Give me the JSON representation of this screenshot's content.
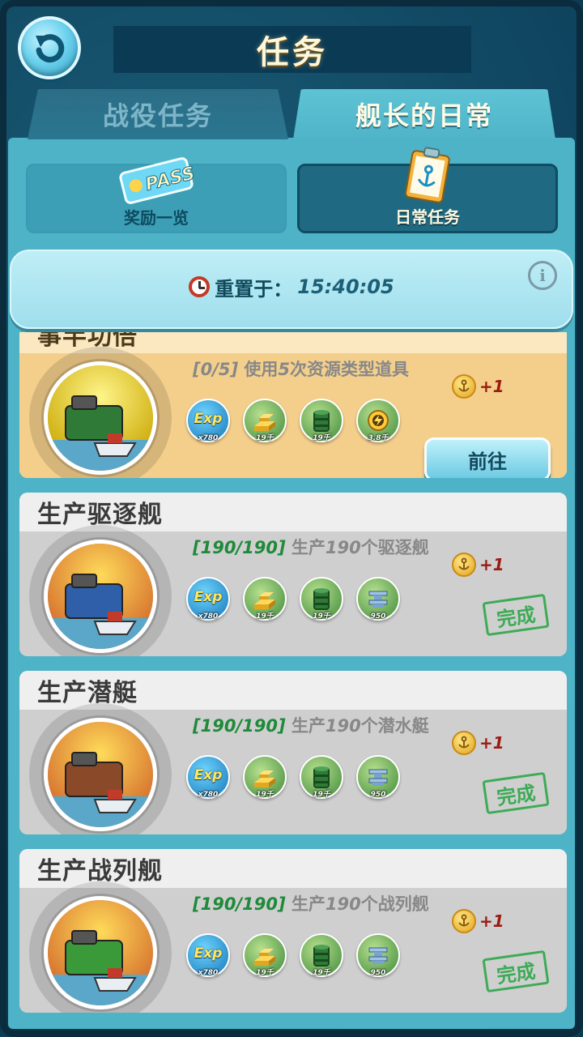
{
  "header": {
    "title": "任务"
  },
  "tabs": [
    {
      "label": "战役任务",
      "active": false
    },
    {
      "label": "舰长的日常",
      "active": true
    }
  ],
  "subtabs": [
    {
      "label": "奖励一览",
      "icon": "pass-ticket-icon",
      "badge": "PASS",
      "active": false
    },
    {
      "label": "日常任务",
      "icon": "clipboard-anchor-icon",
      "active": true
    }
  ],
  "reset": {
    "label": "重置于：",
    "time": "15:40:05"
  },
  "tasks": [
    {
      "title": "事半功倍",
      "progress": "[0/5]",
      "desc_a": "使用",
      "desc_num": "5",
      "desc_b": "次资源类型道具",
      "status": "active",
      "coin_amount": "+1",
      "action_label": "前往",
      "rewards": [
        {
          "icon": "exp-icon",
          "label": "Exp",
          "qty": "x780"
        },
        {
          "icon": "gold-bars-icon",
          "qty": "19千"
        },
        {
          "icon": "oil-barrel-icon",
          "qty": "19千"
        },
        {
          "icon": "energy-icon",
          "qty": "3.8千"
        }
      ]
    },
    {
      "title": "生产驱逐舰",
      "progress": "[190/190]",
      "desc_a": "生产",
      "desc_num": "190",
      "desc_b": "个驱逐舰",
      "status": "done",
      "coin_amount": "+1",
      "stamp_label": "完成",
      "rewards": [
        {
          "icon": "exp-icon",
          "label": "Exp",
          "qty": "x780"
        },
        {
          "icon": "gold-bars-icon",
          "qty": "19千"
        },
        {
          "icon": "oil-barrel-icon",
          "qty": "19千"
        },
        {
          "icon": "steel-icon",
          "qty": "950"
        }
      ]
    },
    {
      "title": "生产潜艇",
      "progress": "[190/190]",
      "desc_a": "生产",
      "desc_num": "190",
      "desc_b": "个潜水艇",
      "status": "done",
      "coin_amount": "+1",
      "stamp_label": "完成",
      "rewards": [
        {
          "icon": "exp-icon",
          "label": "Exp",
          "qty": "x780"
        },
        {
          "icon": "gold-bars-icon",
          "qty": "19千"
        },
        {
          "icon": "oil-barrel-icon",
          "qty": "19千"
        },
        {
          "icon": "steel-icon",
          "qty": "950"
        }
      ]
    },
    {
      "title": "生产战列舰",
      "progress": "[190/190]",
      "desc_a": "生产",
      "desc_num": "190",
      "desc_b": "个战列舰",
      "status": "done",
      "coin_amount": "+1",
      "stamp_label": "完成",
      "rewards": [
        {
          "icon": "exp-icon",
          "label": "Exp",
          "qty": "x780"
        },
        {
          "icon": "gold-bars-icon",
          "qty": "19千"
        },
        {
          "icon": "oil-barrel-icon",
          "qty": "19千"
        },
        {
          "icon": "steel-icon",
          "qty": "950"
        }
      ]
    }
  ],
  "colors": {
    "background": "#0f4560",
    "panel": "#4fb3c7",
    "done_green": "#2ea84a",
    "coin_amount": "#9a1b12"
  }
}
